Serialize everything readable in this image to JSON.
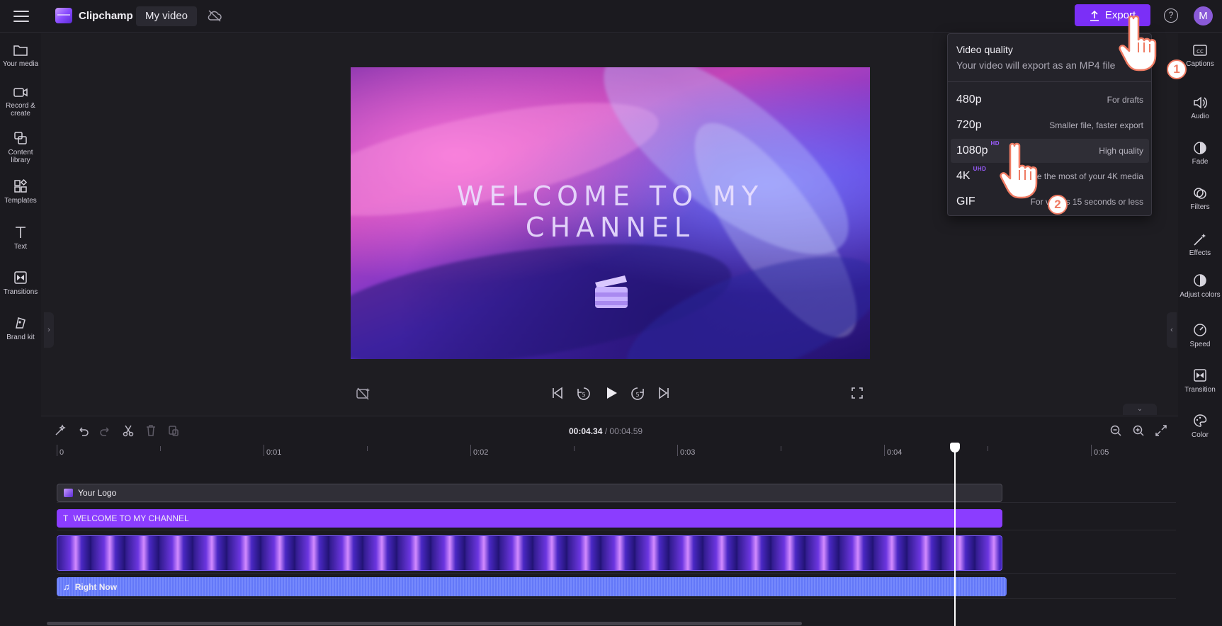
{
  "app": {
    "brand": "Clipchamp",
    "project_name": "My video",
    "export_label": "Export",
    "avatar_initial": "M",
    "accent": "#7b2ff7"
  },
  "left_nav": [
    {
      "label": "Your media",
      "icon": "folder-icon"
    },
    {
      "label": "Record & create",
      "icon": "camera-icon"
    },
    {
      "label": "Content library",
      "icon": "library-icon"
    },
    {
      "label": "Templates",
      "icon": "templates-icon"
    },
    {
      "label": "Text",
      "icon": "text-icon"
    },
    {
      "label": "Transitions",
      "icon": "transitions-icon"
    },
    {
      "label": "Brand kit",
      "icon": "brand-kit-icon"
    }
  ],
  "right_nav": [
    {
      "label": "Captions",
      "icon": "captions-icon"
    },
    {
      "label": "Audio",
      "icon": "audio-icon"
    },
    {
      "label": "Fade",
      "icon": "fade-icon"
    },
    {
      "label": "Filters",
      "icon": "filters-icon"
    },
    {
      "label": "Effects",
      "icon": "effects-icon"
    },
    {
      "label": "Adjust colors",
      "icon": "adjust-colors-icon"
    },
    {
      "label": "Speed",
      "icon": "speed-icon"
    },
    {
      "label": "Transition",
      "icon": "transition-icon"
    },
    {
      "label": "Color",
      "icon": "color-icon"
    }
  ],
  "preview": {
    "title_line1": "WELCOME TO MY",
    "title_line2": "CHANNEL"
  },
  "export_menu": {
    "title": "Video quality",
    "subtitle": "Your video will export as an MP4 file",
    "options": [
      {
        "name": "480p",
        "badge": "",
        "desc": "For drafts"
      },
      {
        "name": "720p",
        "badge": "",
        "desc": "Smaller file, faster export"
      },
      {
        "name": "1080p",
        "badge": "HD",
        "desc": "High quality"
      },
      {
        "name": "4K",
        "badge": "UHD",
        "desc": "Make the most of your 4K media"
      },
      {
        "name": "GIF",
        "badge": "",
        "desc": "For videos 15 seconds or less"
      }
    ]
  },
  "timeline": {
    "current_time": "00:04.34",
    "separator": " / ",
    "total_time": "00:04.59",
    "ruler": [
      "0",
      "0:01",
      "0:02",
      "0:03",
      "0:04",
      "0:05"
    ],
    "playhead_seconds": 4.34,
    "tracks": {
      "logo": "Your Logo",
      "text": "WELCOME TO MY CHANNEL",
      "audio": "Right Now"
    }
  },
  "steps": [
    "1",
    "2"
  ]
}
